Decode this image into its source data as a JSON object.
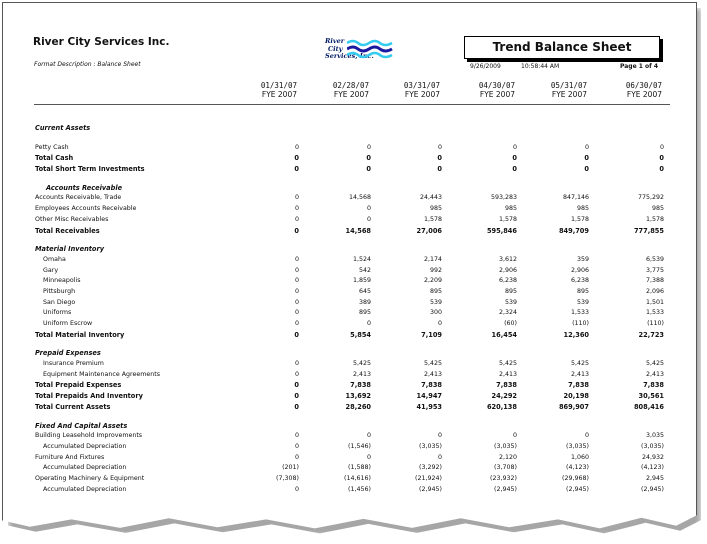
{
  "header": {
    "company": "River City Services Inc.",
    "format_description": "Format Description : Balance Sheet",
    "logo_text": [
      "River",
      "City",
      "Services, Inc."
    ],
    "report_title": "Trend Balance Sheet",
    "date": "9/26/2009",
    "time": "10:58:44 AM",
    "page": "Page 1 of 4"
  },
  "columns": [
    {
      "date": "01/31/07",
      "fye": "FYE 2007"
    },
    {
      "date": "02/28/07",
      "fye": "FYE 2007"
    },
    {
      "date": "03/31/07",
      "fye": "FYE 2007"
    },
    {
      "date": "04/30/07",
      "fye": "FYE 2007"
    },
    {
      "date": "05/31/07",
      "fye": "FYE 2007"
    },
    {
      "date": "06/30/07",
      "fye": "FYE 2007"
    }
  ],
  "rows": [
    {
      "type": "section",
      "label": "Current Assets"
    },
    {
      "type": "item",
      "label": "Petty Cash",
      "values": [
        "0",
        "0",
        "0",
        "0",
        "0",
        "0"
      ]
    },
    {
      "type": "total",
      "label": "Total Cash",
      "values": [
        "0",
        "0",
        "0",
        "0",
        "0",
        "0"
      ]
    },
    {
      "type": "total",
      "label": "Total Short Term Investments",
      "values": [
        "0",
        "0",
        "0",
        "0",
        "0",
        "0"
      ]
    },
    {
      "type": "subsection",
      "label": "Accounts Receivable"
    },
    {
      "type": "item",
      "label": "Accounts Receivable, Trade",
      "values": [
        "0",
        "14,568",
        "24,443",
        "593,283",
        "847,146",
        "775,292"
      ]
    },
    {
      "type": "item",
      "label": "Employees Accounts Receivable",
      "values": [
        "0",
        "0",
        "985",
        "985",
        "985",
        "985"
      ]
    },
    {
      "type": "item",
      "label": "Other Misc Receivables",
      "values": [
        "0",
        "0",
        "1,578",
        "1,578",
        "1,578",
        "1,578"
      ]
    },
    {
      "type": "total",
      "label": "Total Receivables",
      "values": [
        "0",
        "14,568",
        "27,006",
        "595,846",
        "849,709",
        "777,855"
      ]
    },
    {
      "type": "section",
      "label": "Material Inventory"
    },
    {
      "type": "indent",
      "label": "Omaha",
      "values": [
        "0",
        "1,524",
        "2,174",
        "3,612",
        "359",
        "6,539"
      ]
    },
    {
      "type": "indent",
      "label": "Gary",
      "values": [
        "0",
        "542",
        "992",
        "2,906",
        "2,906",
        "3,775"
      ]
    },
    {
      "type": "indent",
      "label": "Minneapolis",
      "values": [
        "0",
        "1,859",
        "2,209",
        "6,238",
        "6,238",
        "7,388"
      ]
    },
    {
      "type": "indent",
      "label": "Pittsburgh",
      "values": [
        "0",
        "645",
        "895",
        "895",
        "895",
        "2,096"
      ]
    },
    {
      "type": "indent",
      "label": "San Diego",
      "values": [
        "0",
        "389",
        "539",
        "539",
        "539",
        "1,501"
      ]
    },
    {
      "type": "indent",
      "label": "Uniforms",
      "values": [
        "0",
        "895",
        "300",
        "2,324",
        "1,533",
        "1,533"
      ]
    },
    {
      "type": "indent",
      "label": "Uniform Escrow",
      "values": [
        "0",
        "0",
        "0",
        "(60)",
        "(110)",
        "(110)"
      ]
    },
    {
      "type": "total",
      "label": "Total Material Inventory",
      "values": [
        "0",
        "5,854",
        "7,109",
        "16,454",
        "12,360",
        "22,723"
      ]
    },
    {
      "type": "section",
      "label": "Prepaid Expenses"
    },
    {
      "type": "indent",
      "label": "Insurance Premium",
      "values": [
        "0",
        "5,425",
        "5,425",
        "5,425",
        "5,425",
        "5,425"
      ]
    },
    {
      "type": "indent",
      "label": "Equipment Maintenance Agreements",
      "values": [
        "0",
        "2,413",
        "2,413",
        "2,413",
        "2,413",
        "2,413"
      ]
    },
    {
      "type": "total",
      "label": "Total Prepaid Expenses",
      "values": [
        "0",
        "7,838",
        "7,838",
        "7,838",
        "7,838",
        "7,838"
      ]
    },
    {
      "type": "total",
      "label": "Total Prepaids And Inventory",
      "values": [
        "0",
        "13,692",
        "14,947",
        "24,292",
        "20,198",
        "30,561"
      ]
    },
    {
      "type": "total",
      "label": "Total Current Assets",
      "values": [
        "0",
        "28,260",
        "41,953",
        "620,138",
        "869,907",
        "808,416"
      ]
    },
    {
      "type": "section",
      "label": "Fixed And Capital Assets"
    },
    {
      "type": "item",
      "label": "Building Leasehold Improvements",
      "values": [
        "0",
        "0",
        "0",
        "0",
        "0",
        "3,035"
      ]
    },
    {
      "type": "indent",
      "label": "Accumulated Depreciation",
      "values": [
        "0",
        "(1,546)",
        "(3,035)",
        "(3,035)",
        "(3,035)",
        "(3,035)"
      ]
    },
    {
      "type": "item",
      "label": "Furniture And Fixtures",
      "values": [
        "0",
        "0",
        "0",
        "2,120",
        "1,060",
        "24,932"
      ]
    },
    {
      "type": "indent",
      "label": "Accumulated Depreciation",
      "values": [
        "(201)",
        "(1,588)",
        "(3,292)",
        "(3,708)",
        "(4,123)",
        "(4,123)"
      ]
    },
    {
      "type": "item",
      "label": "Operating Machinery & Equipment",
      "values": [
        "(7,308)",
        "(14,616)",
        "(21,924)",
        "(23,932)",
        "(29,968)",
        "2,945"
      ]
    },
    {
      "type": "indent",
      "label": "Accumulated Depreciation",
      "values": [
        "0",
        "(1,456)",
        "(2,945)",
        "(2,945)",
        "(2,945)",
        "(2,945)"
      ]
    }
  ],
  "colors": {
    "logo_dark": "#1a1aa0",
    "logo_light": "#33ccee"
  }
}
